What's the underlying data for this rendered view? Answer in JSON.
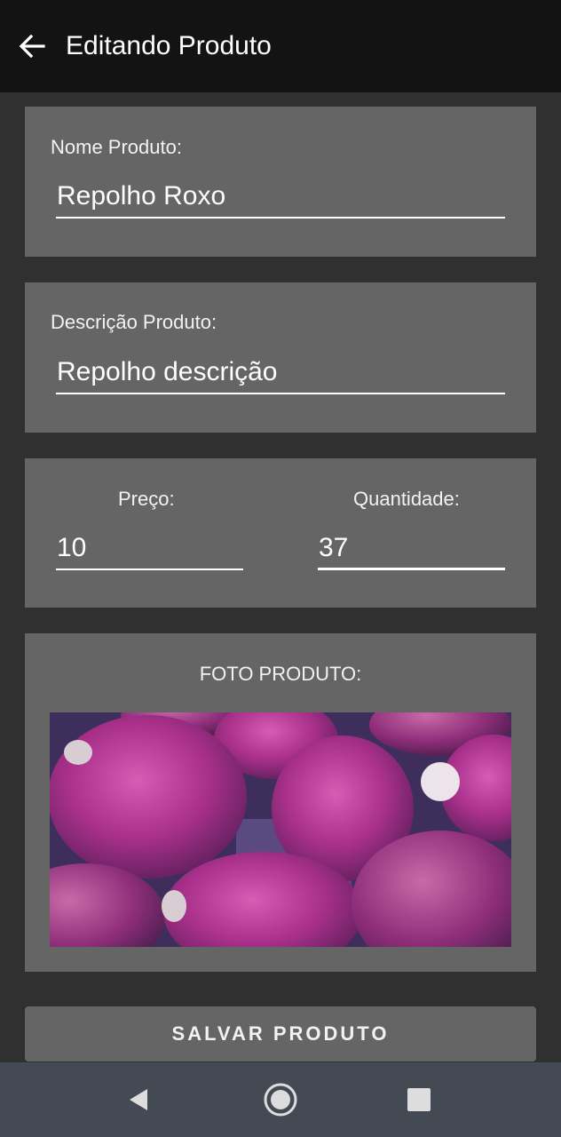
{
  "appbar": {
    "title": "Editando Produto",
    "back_icon": "arrow-left-icon"
  },
  "name_card": {
    "label": "Nome Produto:",
    "value": "Repolho Roxo"
  },
  "description_card": {
    "label": "Descrição Produto:",
    "value": "Repolho descrição"
  },
  "price_card": {
    "price_label": "Preço:",
    "price_value": "10",
    "quantity_label": "Quantidade:",
    "quantity_value": "37"
  },
  "photo_card": {
    "label": "FOTO PRODUTO:"
  },
  "save_button": {
    "label": "SALVAR PRODUTO"
  },
  "system_nav": {
    "icons": [
      "back-triangle-icon",
      "home-circle-icon",
      "recents-square-icon"
    ]
  },
  "colors": {
    "appbar": "#131313",
    "background": "#303030",
    "card": "#656565",
    "navbar": "#434a53"
  }
}
